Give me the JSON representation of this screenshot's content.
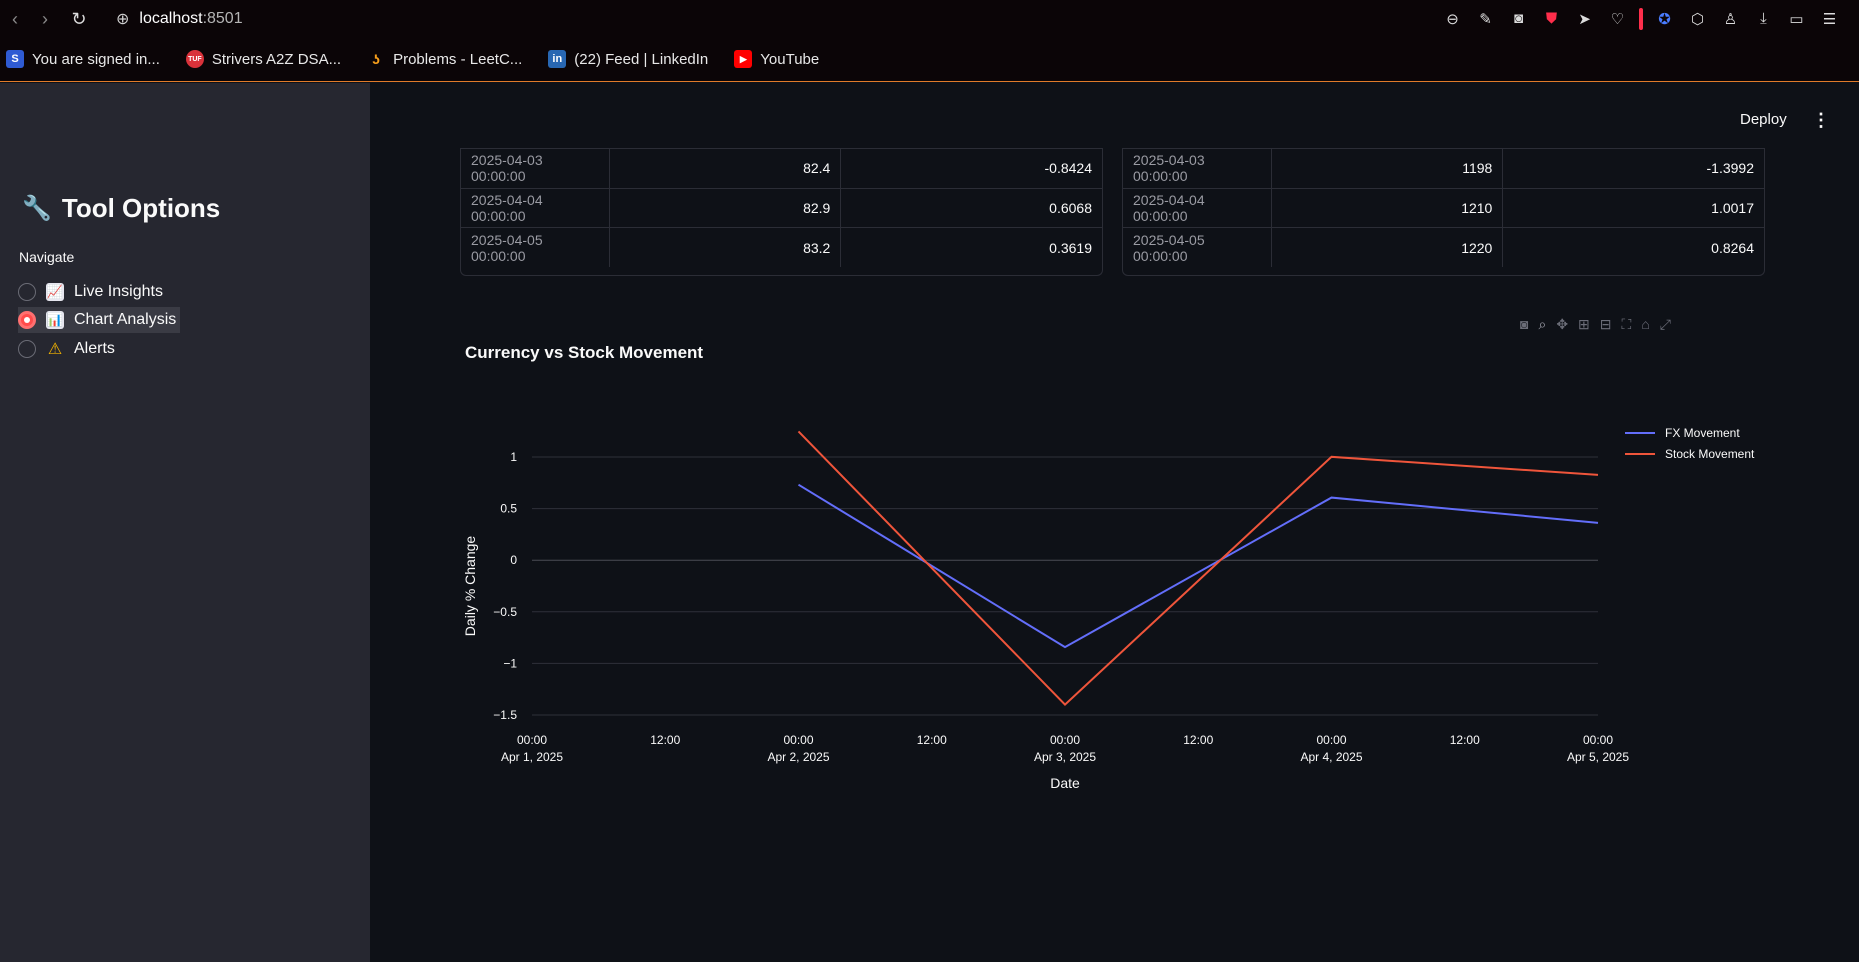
{
  "browser": {
    "host": "localhost",
    "port": ":8501",
    "bookmarks": [
      {
        "label": "You are signed in...",
        "icon": "S",
        "color": "#2f5bd3"
      },
      {
        "label": "Strivers A2Z DSA...",
        "icon": "TUF",
        "color": "#d9323a"
      },
      {
        "label": "Problems - LeetC...",
        "icon": "leetcode-icon",
        "color": "#f89f1b"
      },
      {
        "label": "(22) Feed | LinkedIn",
        "icon": "in",
        "color": "#2867b2"
      },
      {
        "label": "YouTube",
        "icon": "youtube-icon",
        "color": "#ff0000"
      }
    ]
  },
  "sidebar": {
    "title": "Tool Options",
    "nav_label": "Navigate",
    "options": [
      {
        "label": "Live Insights",
        "icon": "chart-up-icon",
        "selected": false
      },
      {
        "label": "Chart Analysis",
        "icon": "bar-chart-icon",
        "selected": true
      },
      {
        "label": "Alerts",
        "icon": "warning-icon",
        "selected": false
      }
    ]
  },
  "header": {
    "deploy_label": "Deploy",
    "menu_label": "⋮"
  },
  "fx_table": {
    "rows": [
      [
        "2025-04-03 00:00:00",
        "82.4",
        "-0.8424"
      ],
      [
        "2025-04-04 00:00:00",
        "82.9",
        "0.6068"
      ],
      [
        "2025-04-05 00:00:00",
        "83.2",
        "0.3619"
      ]
    ]
  },
  "stock_table": {
    "rows": [
      [
        "2025-04-03 00:00:00",
        "1198",
        "-1.3992"
      ],
      [
        "2025-04-04 00:00:00",
        "1210",
        "1.0017"
      ],
      [
        "2025-04-05 00:00:00",
        "1220",
        "0.8264"
      ]
    ]
  },
  "chart_data": {
    "type": "line",
    "title": "Currency vs Stock Movement",
    "xlabel": "Date",
    "ylabel": "Daily % Change",
    "x": [
      "2025-04-02",
      "2025-04-03",
      "2025-04-04",
      "2025-04-05"
    ],
    "series": [
      {
        "name": "FX Movement",
        "color": "#636efa",
        "values": [
          0.7317,
          -0.8424,
          0.6068,
          0.3619
        ]
      },
      {
        "name": "Stock Movement",
        "color": "#ef553b",
        "values": [
          1.2478,
          -1.3992,
          1.0017,
          0.8264
        ]
      }
    ],
    "xlim": [
      "2025-04-01",
      "2025-04-05"
    ],
    "ylim": [
      -1.5,
      1.3
    ],
    "yticks": [
      1,
      0.5,
      0,
      -0.5,
      -1,
      -1.5
    ],
    "ytick_labels": [
      "1",
      "0.5",
      "0",
      "−0.5",
      "−1",
      "−1.5"
    ],
    "xticks": [
      {
        "line1": "00:00",
        "line2": "Apr 1, 2025"
      },
      {
        "line1": "12:00",
        "line2": ""
      },
      {
        "line1": "00:00",
        "line2": "Apr 2, 2025"
      },
      {
        "line1": "12:00",
        "line2": ""
      },
      {
        "line1": "00:00",
        "line2": "Apr 3, 2025"
      },
      {
        "line1": "12:00",
        "line2": ""
      },
      {
        "line1": "00:00",
        "line2": "Apr 4, 2025"
      },
      {
        "line1": "12:00",
        "line2": ""
      },
      {
        "line1": "00:00",
        "line2": "Apr 5, 2025"
      }
    ],
    "grid": true,
    "legend": "top-right"
  }
}
